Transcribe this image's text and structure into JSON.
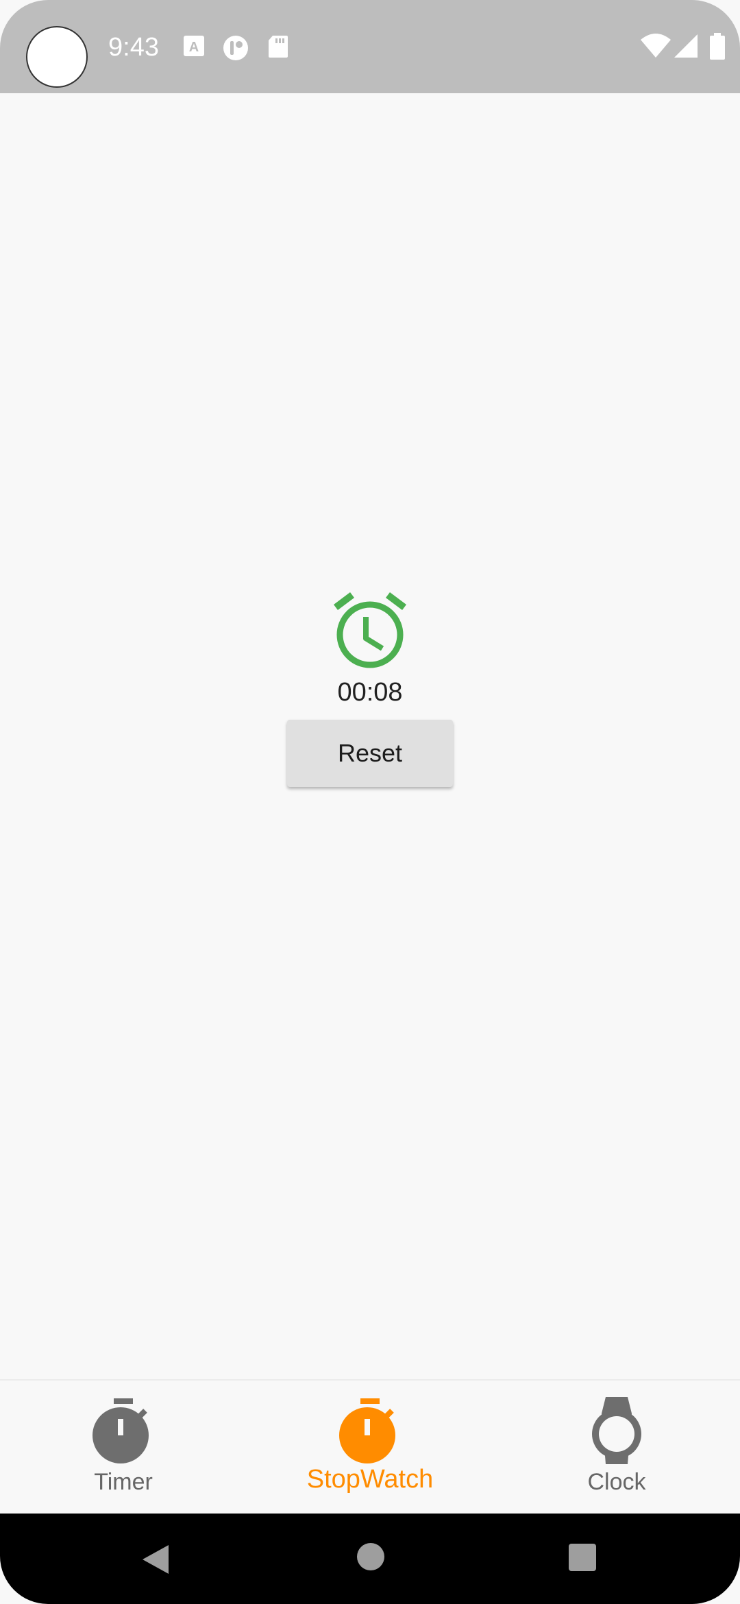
{
  "status_bar": {
    "time": "9:43",
    "icons": [
      "a-icon",
      "data-saver-icon",
      "sd-card-icon"
    ],
    "right_icons": [
      "wifi-icon",
      "signal-icon",
      "battery-icon"
    ]
  },
  "main": {
    "icon": "alarm-clock-icon",
    "icon_color": "#4caf50",
    "elapsed_time": "00:08",
    "reset_label": "Reset"
  },
  "bottom_nav": {
    "active_color": "#ff8c00",
    "inactive_color": "#6e6e6e",
    "items": [
      {
        "label": "Timer",
        "icon": "stopwatch-icon",
        "active": false
      },
      {
        "label": "StopWatch",
        "icon": "stopwatch-icon",
        "active": true
      },
      {
        "label": "Clock",
        "icon": "watch-icon",
        "active": false
      }
    ]
  },
  "system_nav": {
    "buttons": [
      "back-icon",
      "home-icon",
      "recents-icon"
    ]
  }
}
